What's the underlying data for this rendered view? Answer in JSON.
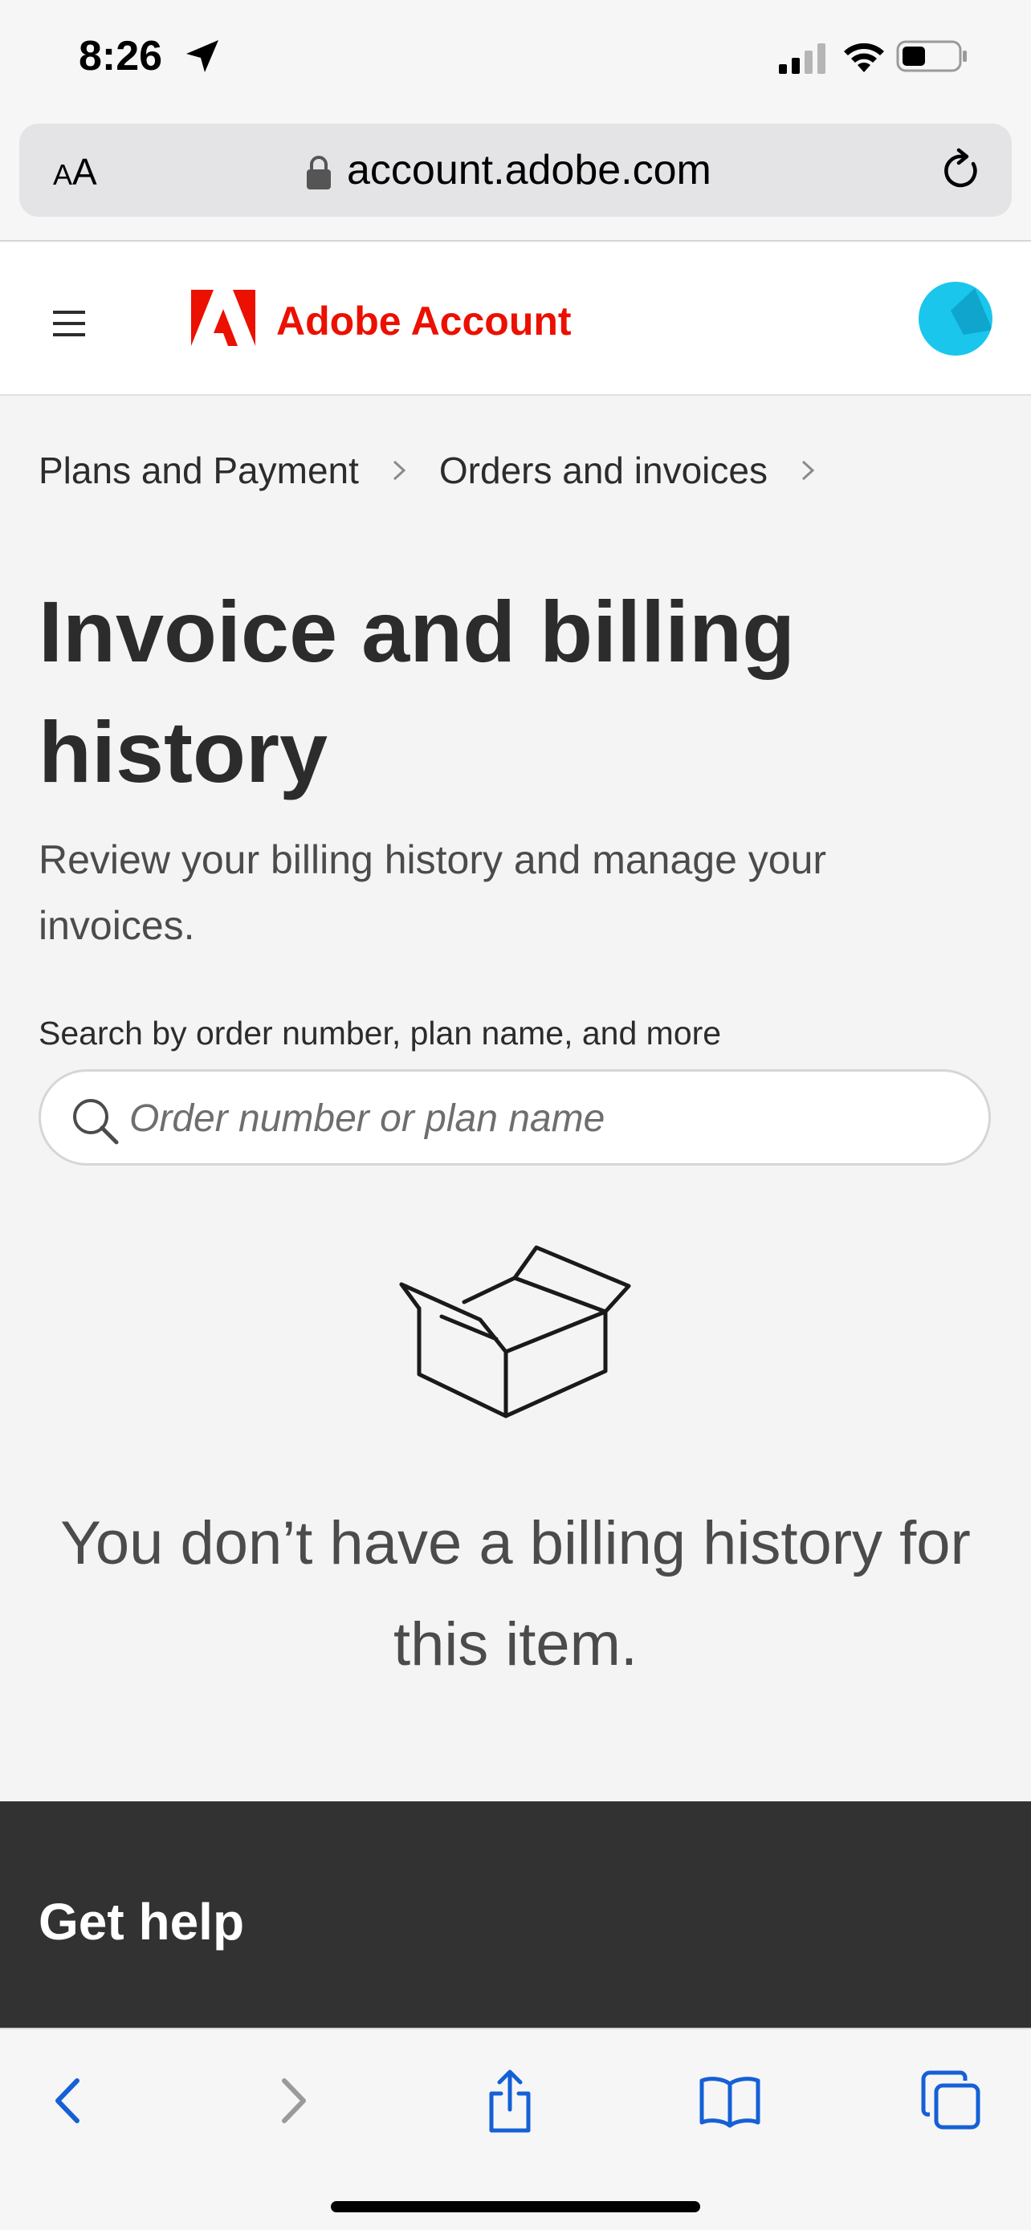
{
  "status_bar": {
    "time": "8:26",
    "icons": [
      "location-arrow-icon",
      "cellular-signal-icon",
      "wifi-icon",
      "battery-icon"
    ]
  },
  "browser": {
    "text_size_label_small": "A",
    "text_size_label_large": "A",
    "url": "account.adobe.com"
  },
  "header": {
    "app_title": "Adobe Account",
    "brand_color": "#eb1000",
    "avatar_color": "#1ac6ec"
  },
  "breadcrumb": {
    "items": [
      "Plans and Payment",
      "Orders and invoices"
    ]
  },
  "main": {
    "title": "Invoice and billing history",
    "subtitle": "Review your billing history and manage your invoices.",
    "search": {
      "label": "Search by order number, plan name, and more",
      "placeholder": "Order number or plan name",
      "value": ""
    },
    "empty_state": {
      "icon": "open-box-icon",
      "message": "You don’t have a billing history for this item."
    }
  },
  "footer": {
    "help_title": "Get help"
  },
  "toolbar": {
    "buttons": [
      "back-icon",
      "forward-icon",
      "share-icon",
      "bookmarks-icon",
      "tabs-icon"
    ],
    "accent_color": "#1560d6"
  }
}
